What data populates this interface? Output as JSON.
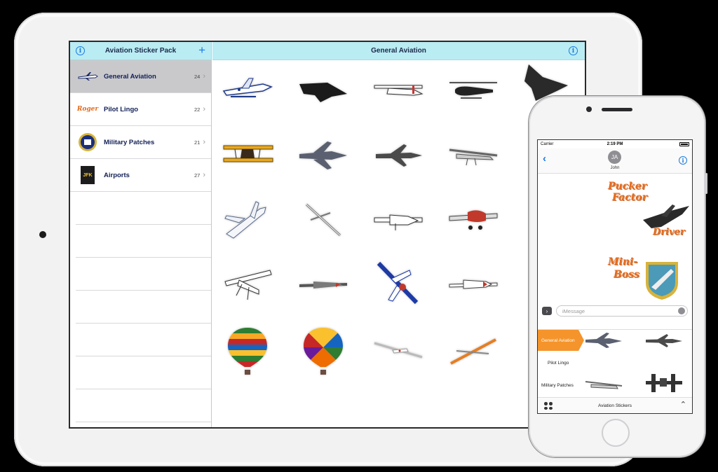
{
  "ipad": {
    "master": {
      "title": "Aviation Sticker Pack",
      "info_icon": "info-icon",
      "add_icon": "plus-icon",
      "packs": [
        {
          "label": "General Aviation",
          "count": "24",
          "thumb": "Airplane",
          "selected": true
        },
        {
          "label": "Pilot Lingo",
          "count": "22",
          "thumb": "Roger",
          "selected": false
        },
        {
          "label": "Military Patches",
          "count": "21",
          "thumb": "patch",
          "selected": false
        },
        {
          "label": "Airports",
          "count": "27",
          "thumb": "JFK",
          "selected": false
        }
      ]
    },
    "detail": {
      "title": "General Aviation",
      "stickers": [
        "seaplane",
        "stealth-fighter",
        "cessna",
        "helicopter",
        "sr71",
        "biplane",
        "f22-fighter",
        "f16-fighter",
        "predator-drone",
        "drone-partial",
        "business-jet",
        "wireframe-plane",
        "aerobatic-plane",
        "warbird",
        "partial",
        "cessna-outline",
        "p51-mustang",
        "red-white-blue-jet",
        "pilatus",
        "partial",
        "hot-air-balloon-stripes",
        "hot-air-balloon-colors",
        "white-glider",
        "orange-glider"
      ]
    }
  },
  "iphone": {
    "status": {
      "carrier": "Carrier",
      "time": "2:19 PM"
    },
    "contact": {
      "initials": "JA",
      "name": "John"
    },
    "thread": {
      "sticker1": {
        "line1": "Pucker",
        "line2": "Factor",
        "line3": "Driver"
      },
      "sticker2": {
        "line1": "Mini-",
        "line2": "Boss"
      }
    },
    "compose": {
      "placeholder": "iMessage"
    },
    "drawer": {
      "tabs": [
        {
          "label": "General Aviation",
          "active": true
        },
        {
          "label": "Pilot Lingo",
          "active": false
        },
        {
          "label": "Military Patches",
          "active": false
        }
      ],
      "title": "Aviation Stickers"
    }
  },
  "colors": {
    "nav_bar": "#b9ecf3",
    "accent": "#1a7ae0",
    "selected_row": "#c9c9cc",
    "active_tab": "#f4942b",
    "lingo": "#e36a1c"
  }
}
